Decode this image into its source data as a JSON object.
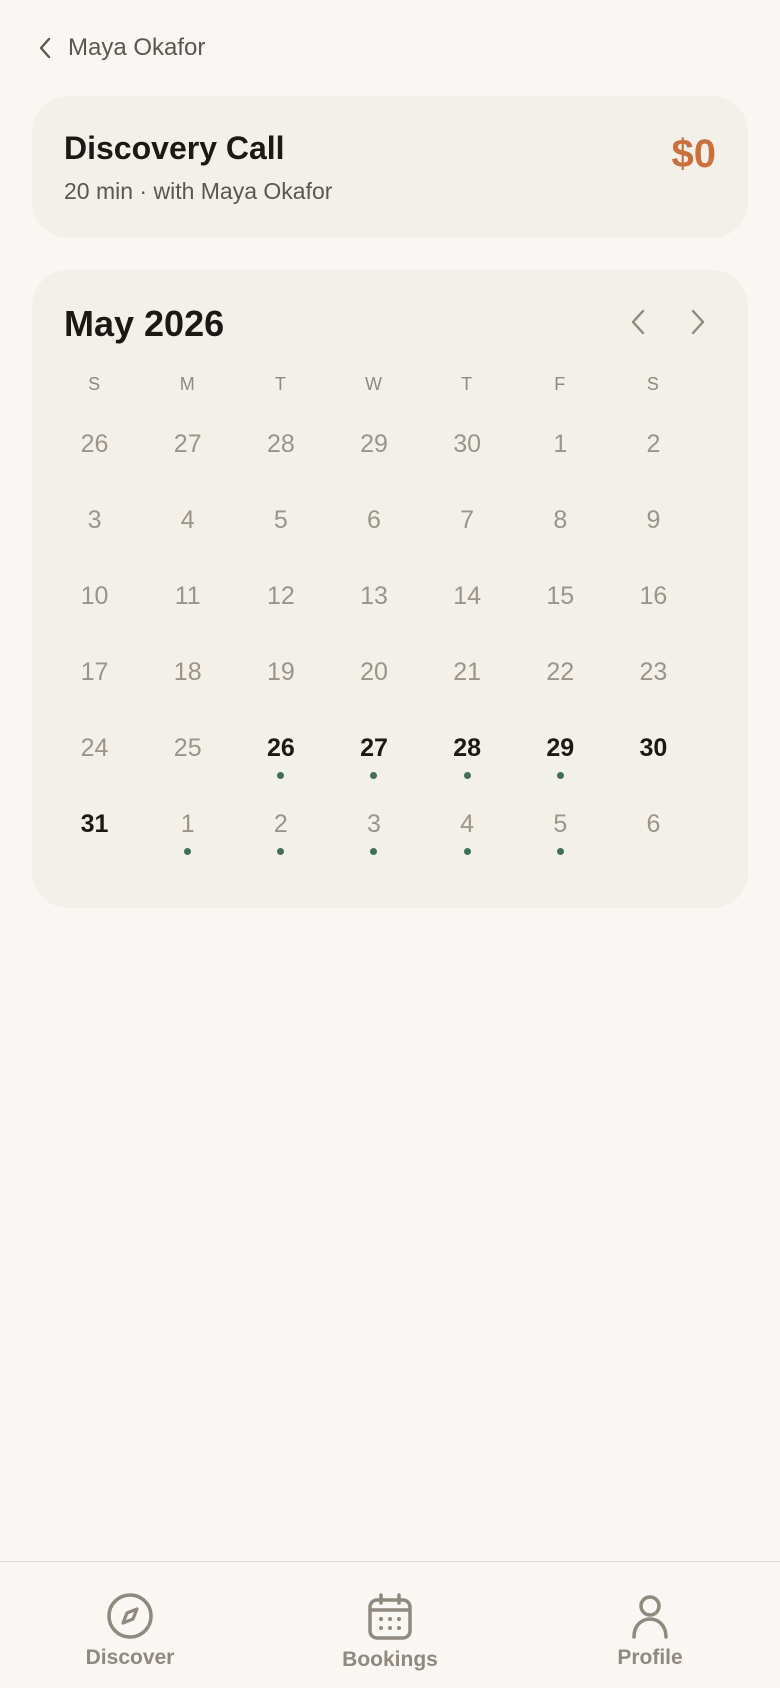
{
  "header": {
    "back_label": "Maya Okafor"
  },
  "service": {
    "title": "Discovery Call",
    "subtitle": "20 min · with Maya Okafor",
    "price": "$0"
  },
  "calendar": {
    "month_label": "May 2026",
    "weekdays": [
      "S",
      "M",
      "T",
      "W",
      "T",
      "F",
      "S"
    ],
    "days": [
      {
        "label": "26",
        "available": false,
        "has_slots": false
      },
      {
        "label": "27",
        "available": false,
        "has_slots": false
      },
      {
        "label": "28",
        "available": false,
        "has_slots": false
      },
      {
        "label": "29",
        "available": false,
        "has_slots": false
      },
      {
        "label": "30",
        "available": false,
        "has_slots": false
      },
      {
        "label": "1",
        "available": false,
        "has_slots": false
      },
      {
        "label": "2",
        "available": false,
        "has_slots": false
      },
      {
        "label": "3",
        "available": false,
        "has_slots": false
      },
      {
        "label": "4",
        "available": false,
        "has_slots": false
      },
      {
        "label": "5",
        "available": false,
        "has_slots": false
      },
      {
        "label": "6",
        "available": false,
        "has_slots": false
      },
      {
        "label": "7",
        "available": false,
        "has_slots": false
      },
      {
        "label": "8",
        "available": false,
        "has_slots": false
      },
      {
        "label": "9",
        "available": false,
        "has_slots": false
      },
      {
        "label": "10",
        "available": false,
        "has_slots": false
      },
      {
        "label": "11",
        "available": false,
        "has_slots": false
      },
      {
        "label": "12",
        "available": false,
        "has_slots": false
      },
      {
        "label": "13",
        "available": false,
        "has_slots": false
      },
      {
        "label": "14",
        "available": false,
        "has_slots": false
      },
      {
        "label": "15",
        "available": false,
        "has_slots": false
      },
      {
        "label": "16",
        "available": false,
        "has_slots": false
      },
      {
        "label": "17",
        "available": false,
        "has_slots": false
      },
      {
        "label": "18",
        "available": false,
        "has_slots": false
      },
      {
        "label": "19",
        "available": false,
        "has_slots": false
      },
      {
        "label": "20",
        "available": false,
        "has_slots": false
      },
      {
        "label": "21",
        "available": false,
        "has_slots": false
      },
      {
        "label": "22",
        "available": false,
        "has_slots": false
      },
      {
        "label": "23",
        "available": false,
        "has_slots": false
      },
      {
        "label": "24",
        "available": false,
        "has_slots": false
      },
      {
        "label": "25",
        "available": false,
        "has_slots": false
      },
      {
        "label": "26",
        "available": true,
        "has_slots": true
      },
      {
        "label": "27",
        "available": true,
        "has_slots": true
      },
      {
        "label": "28",
        "available": true,
        "has_slots": true
      },
      {
        "label": "29",
        "available": true,
        "has_slots": true
      },
      {
        "label": "30",
        "available": true,
        "has_slots": false
      },
      {
        "label": "31",
        "available": true,
        "has_slots": false
      },
      {
        "label": "1",
        "available": false,
        "has_slots": true
      },
      {
        "label": "2",
        "available": false,
        "has_slots": true
      },
      {
        "label": "3",
        "available": false,
        "has_slots": true
      },
      {
        "label": "4",
        "available": false,
        "has_slots": true
      },
      {
        "label": "5",
        "available": false,
        "has_slots": true
      },
      {
        "label": "6",
        "available": false,
        "has_slots": false
      }
    ]
  },
  "tabbar": {
    "items": [
      {
        "label": "Discover",
        "icon": "compass-icon"
      },
      {
        "label": "Bookings",
        "icon": "calendar-icon"
      },
      {
        "label": "Profile",
        "icon": "user-icon"
      }
    ]
  },
  "colors": {
    "accent_price": "#c9703e",
    "slot_dot": "#3f6e5c",
    "background": "#f9f7f3",
    "card": "#f3f0ea"
  }
}
